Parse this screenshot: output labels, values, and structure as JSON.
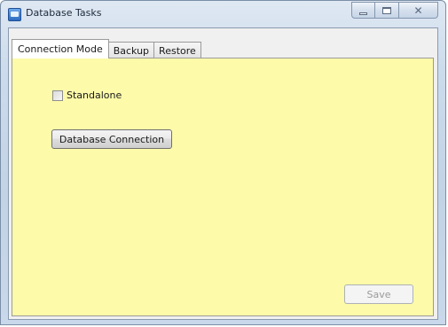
{
  "window": {
    "title": "Database Tasks",
    "close_symbol": "✕"
  },
  "tabs": [
    {
      "label": "Connection Mode",
      "active": true
    },
    {
      "label": "Backup",
      "active": false
    },
    {
      "label": "Restore",
      "active": false
    }
  ],
  "panel": {
    "background_color": "#fdfaa9",
    "standalone_label": "Standalone",
    "standalone_checked": false,
    "db_connection_label": "Database Connection",
    "save_label": "Save",
    "save_enabled": false
  },
  "icons": {
    "app": "database-app-icon",
    "minimize": "minimize-icon",
    "maximize": "maximize-icon",
    "close": "close-icon"
  }
}
